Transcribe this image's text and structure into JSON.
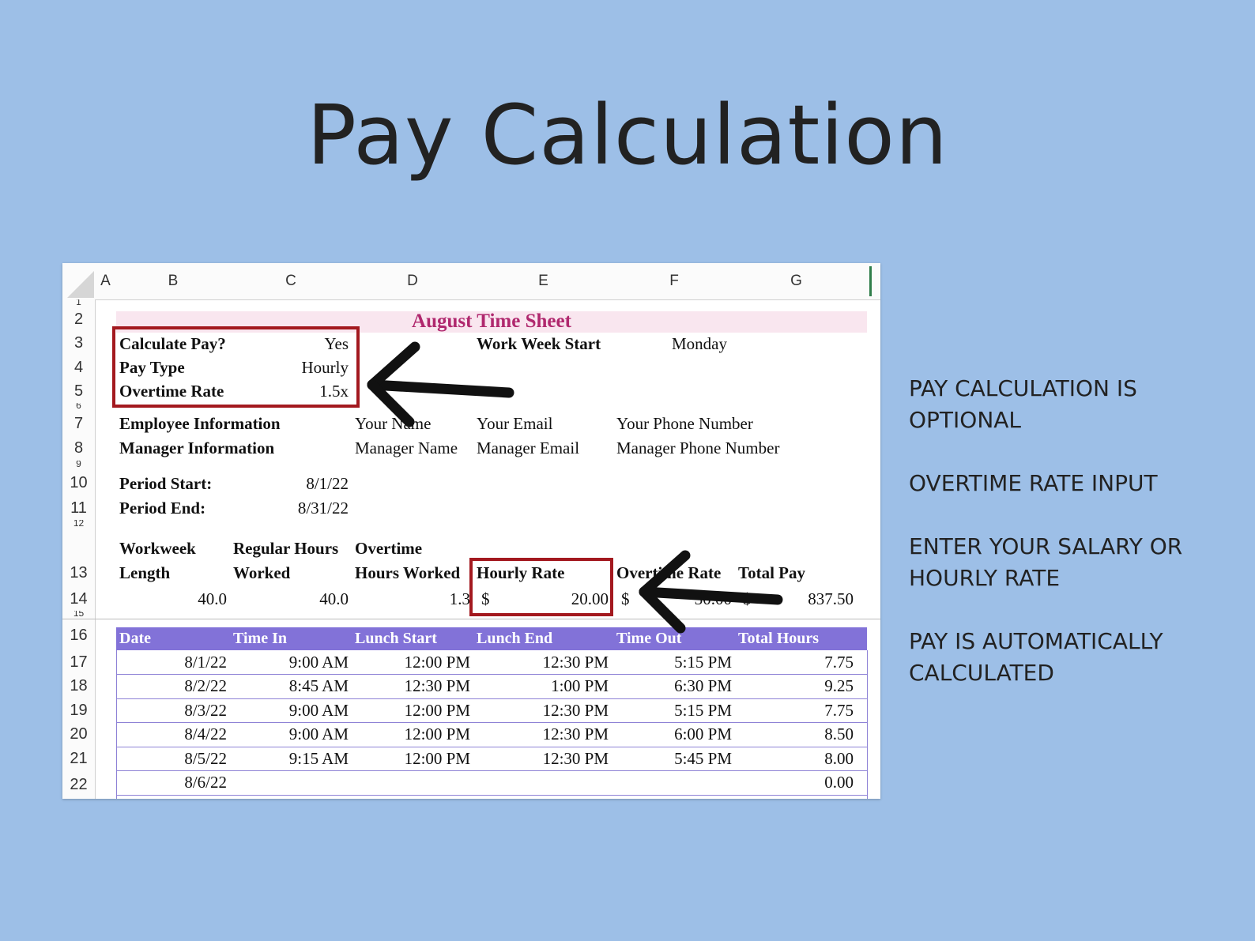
{
  "slide": {
    "title": "Pay Calculation",
    "notes": [
      "PAY CALCULATION IS OPTIONAL",
      "OVERTIME RATE INPUT",
      "ENTER YOUR SALARY OR HOURLY RATE",
      "PAY IS AUTOMATICALLY CALCULATED"
    ]
  },
  "spreadsheet": {
    "columns": [
      "A",
      "B",
      "C",
      "D",
      "E",
      "F",
      "G"
    ],
    "row_numbers": [
      "1",
      "2",
      "3",
      "4",
      "5",
      "6",
      "7",
      "8",
      "9",
      "10",
      "11",
      "12",
      "13",
      "14",
      "15",
      "16",
      "17",
      "18",
      "19",
      "20",
      "21",
      "22"
    ],
    "sheet_title": "August Time Sheet",
    "settings": {
      "calculate_pay_label": "Calculate Pay?",
      "calculate_pay_value": "Yes",
      "pay_type_label": "Pay Type",
      "pay_type_value": "Hourly",
      "overtime_rate_label": "Overtime Rate",
      "overtime_rate_value": "1.5x",
      "work_week_start_label": "Work Week Start",
      "work_week_start_value": "Monday"
    },
    "employee": {
      "label": "Employee Information",
      "name": "Your Name",
      "email": "Your Email",
      "phone": "Your Phone Number"
    },
    "manager": {
      "label": "Manager Information",
      "name": "Manager Name",
      "email": "Manager Email",
      "phone": "Manager Phone Number"
    },
    "period": {
      "start_label": "Period Start:",
      "start_value": "8/1/22",
      "end_label": "Period End:",
      "end_value": "8/31/22"
    },
    "summary": {
      "workweek_line1": "Workweek",
      "workweek_line2": "Length",
      "regular_line1": "Regular Hours",
      "regular_line2": "Worked",
      "overtime_line1": "Overtime",
      "overtime_line2": "Hours Worked",
      "hourly_rate_label": "Hourly Rate",
      "overtime_rate_label": "Overtime Rate",
      "total_pay_label": "Total Pay",
      "workweek_value": "40.0",
      "regular_value": "40.0",
      "overtime_value": "1.3",
      "currency": "$",
      "hourly_rate_value": "20.00",
      "overtime_rate_value": "30.00",
      "total_pay_value": "837.50"
    },
    "table": {
      "headers": [
        "Date",
        "Time In",
        "Lunch Start",
        "Lunch End",
        "Time Out",
        "Total Hours"
      ],
      "rows": [
        [
          "8/1/22",
          "9:00 AM",
          "12:00 PM",
          "12:30 PM",
          "5:15 PM",
          "7.75"
        ],
        [
          "8/2/22",
          "8:45 AM",
          "12:30 PM",
          "1:00 PM",
          "6:30 PM",
          "9.25"
        ],
        [
          "8/3/22",
          "9:00 AM",
          "12:00 PM",
          "12:30 PM",
          "5:15 PM",
          "7.75"
        ],
        [
          "8/4/22",
          "9:00 AM",
          "12:00 PM",
          "12:30 PM",
          "6:00 PM",
          "8.50"
        ],
        [
          "8/5/22",
          "9:15 AM",
          "12:00 PM",
          "12:30 PM",
          "5:45 PM",
          "8.00"
        ],
        [
          "8/6/22",
          "",
          "",
          "",
          "",
          "0.00"
        ]
      ]
    }
  }
}
